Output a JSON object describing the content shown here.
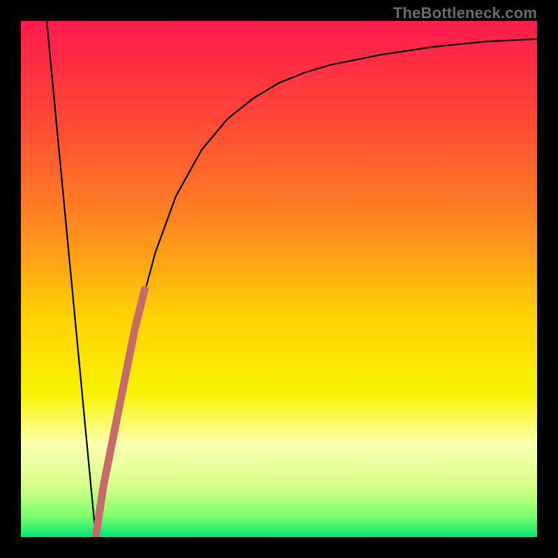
{
  "watermark": "TheBottleneck.com",
  "colors": {
    "frame": "#000000",
    "gradient_stops": [
      {
        "offset": 0.0,
        "color": "#ff1a4d"
      },
      {
        "offset": 0.2,
        "color": "#ff4a35"
      },
      {
        "offset": 0.4,
        "color": "#ff8a1f"
      },
      {
        "offset": 0.58,
        "color": "#ffd400"
      },
      {
        "offset": 0.72,
        "color": "#f7f200"
      },
      {
        "offset": 0.82,
        "color": "#fbffb0"
      },
      {
        "offset": 0.9,
        "color": "#d8ff8a"
      },
      {
        "offset": 0.96,
        "color": "#7cff6b"
      },
      {
        "offset": 1.0,
        "color": "#00e676"
      }
    ],
    "curve": "#000000",
    "highlight": "#c96a6a"
  },
  "chart_data": {
    "type": "line",
    "title": "",
    "xlabel": "",
    "ylabel": "",
    "xlim": [
      0,
      100
    ],
    "ylim": [
      0,
      100
    ],
    "grid": false,
    "legend": false,
    "series": [
      {
        "name": "bottleneck-curve",
        "x": [
          5,
          10,
          14.5,
          18,
          22,
          26,
          30,
          35,
          40,
          45,
          50,
          55,
          60,
          70,
          80,
          90,
          100
        ],
        "y": [
          100,
          50,
          0,
          18,
          40,
          55,
          66,
          75,
          81,
          85,
          88,
          90,
          91.5,
          93.5,
          95,
          96,
          96.5
        ]
      },
      {
        "name": "highlight-segment",
        "x": [
          14.5,
          16,
          18,
          20,
          22,
          24
        ],
        "y": [
          0,
          10,
          20,
          30,
          40,
          48
        ]
      }
    ],
    "annotations": []
  }
}
